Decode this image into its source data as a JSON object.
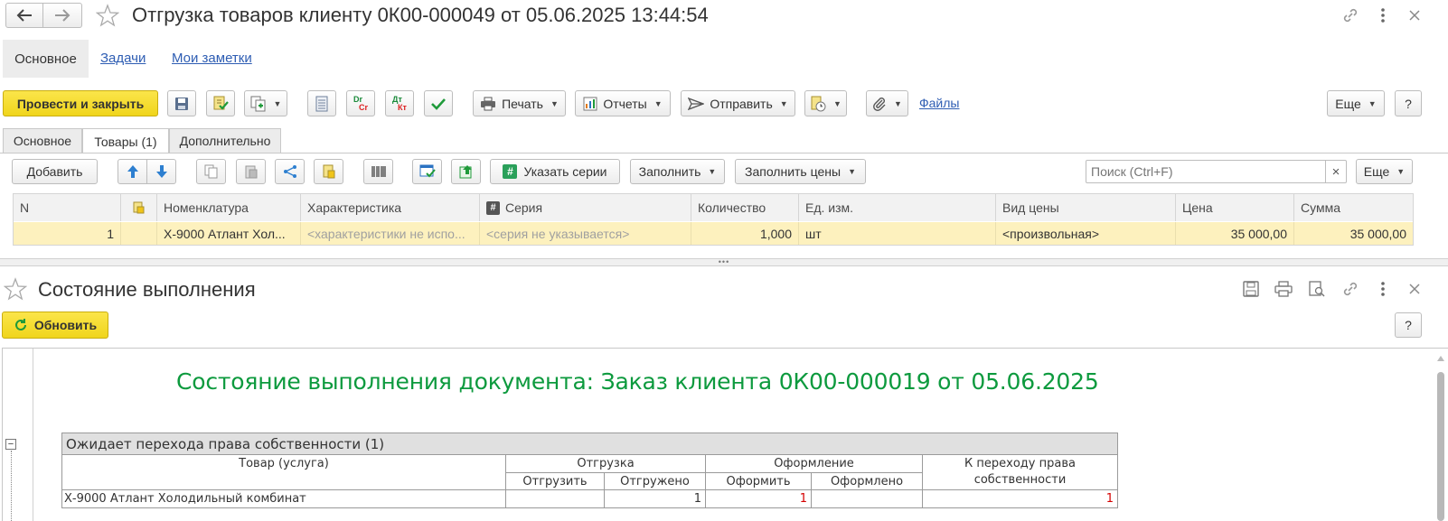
{
  "window": {
    "title": "Отгрузка товаров клиенту 0К00-000049 от 05.06.2025 13:44:54"
  },
  "nav_tabs": [
    {
      "label": "Основное"
    },
    {
      "label": "Задачи"
    },
    {
      "label": "Мои заметки"
    }
  ],
  "toolbar": {
    "post_close": "Провести и закрыть",
    "print": "Печать",
    "reports": "Отчеты",
    "send": "Отправить",
    "files": "Файлы",
    "more": "Еще",
    "help": "?"
  },
  "doc_tabs": [
    {
      "label": "Основное"
    },
    {
      "label": "Товары (1)"
    },
    {
      "label": "Дополнительно"
    }
  ],
  "items_toolbar": {
    "add": "Добавить",
    "series": "Указать серии",
    "fill": "Заполнить",
    "fill_prices": "Заполнить цены",
    "search_placeholder": "Поиск (Ctrl+F)",
    "clear": "×",
    "more": "Еще"
  },
  "grid": {
    "columns": [
      "N",
      "",
      "Номенклатура",
      "Характеристика",
      "Серия",
      "Количество",
      "Ед. изм.",
      "Вид цены",
      "Цена",
      "Сумма"
    ],
    "rows": [
      {
        "n": "1",
        "item": "Х-9000 Атлант Хол...",
        "characteristic": "<характеристики не испо...",
        "series": "<серия не указывается>",
        "qty": "1,000",
        "unit": "шт",
        "price_type": "<произвольная>",
        "price": "35 000,00",
        "sum": "35 000,00"
      }
    ]
  },
  "splitter": "•••",
  "status_panel": {
    "title": "Состояние выполнения",
    "refresh": "Обновить",
    "help": "?"
  },
  "report": {
    "heading": "Состояние выполнения документа: Заказ клиента 0К00-000019 от 05.06.2025",
    "group_title": "Ожидает перехода права собственности (1)",
    "headers": {
      "product": "Товар (услуга)",
      "shipment": "Отгрузка",
      "to_ship": "Отгрузить",
      "shipped": "Отгружено",
      "registration": "Оформление",
      "to_register": "Оформить",
      "registered": "Оформлено",
      "ownership_l1": "К переходу права",
      "ownership_l2": "собственности"
    },
    "rows": [
      {
        "product": "Х-9000 Атлант Холодильный комбинат",
        "to_ship": "",
        "shipped": "1",
        "to_register": "1",
        "registered": "",
        "ownership": "1"
      }
    ],
    "collapse_sign": "−"
  },
  "colors": {
    "accent_yellow": "#f5dc2a",
    "heading_green": "#0d9a3e",
    "row_highlight": "#fdf1be",
    "link_blue": "#2e5db3"
  }
}
